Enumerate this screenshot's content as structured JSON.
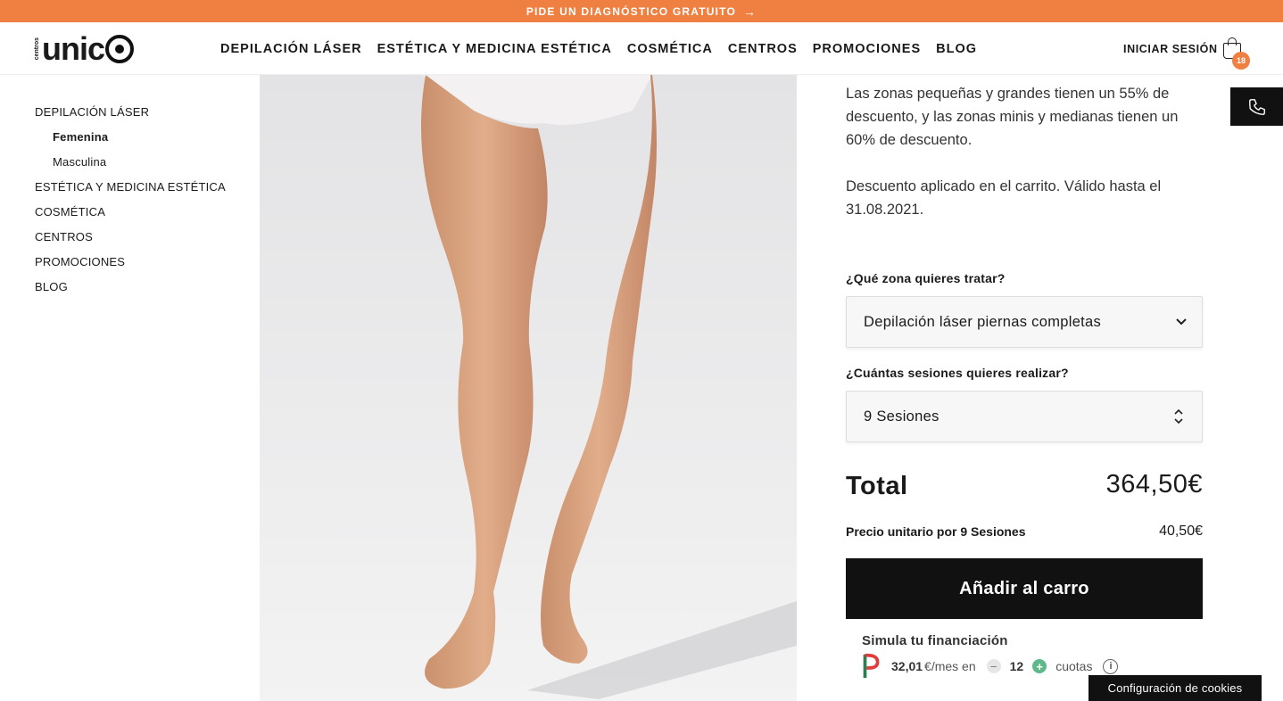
{
  "promo_bar": {
    "text": "PIDE UN DIAGNÓSTICO GRATUITO",
    "arrow": "→"
  },
  "logo": {
    "small": "centros",
    "word": "unic"
  },
  "nav": [
    "DEPILACIÓN LÁSER",
    "ESTÉTICA Y MEDICINA ESTÉTICA",
    "COSMÉTICA",
    "CENTROS",
    "PROMOCIONES",
    "BLOG"
  ],
  "header": {
    "login": "INICIAR SESIÓN",
    "cart_count": "18"
  },
  "sidebar": {
    "items": [
      {
        "label": "DEPILACIÓN LÁSER",
        "sub": false,
        "active": false
      },
      {
        "label": "Femenina",
        "sub": true,
        "active": true
      },
      {
        "label": "Masculina",
        "sub": true,
        "active": false
      },
      {
        "label": "ESTÉTICA Y MEDICINA ESTÉTICA",
        "sub": false,
        "active": false
      },
      {
        "label": "COSMÉTICA",
        "sub": false,
        "active": false
      },
      {
        "label": "CENTROS",
        "sub": false,
        "active": false
      },
      {
        "label": "PROMOCIONES",
        "sub": false,
        "active": false
      },
      {
        "label": "BLOG",
        "sub": false,
        "active": false
      }
    ]
  },
  "product": {
    "desc1": "Las zonas pequeñas y grandes tienen un 55% de descuento, y las zonas minis y medianas tienen un 60% de descuento.",
    "desc2": "Descuento aplicado en el carrito. Válido hasta el 31.08.2021.",
    "zone_label": "¿Qué zona quieres tratar?",
    "zone_value": "Depilación láser piernas completas",
    "sessions_label": "¿Cuántas sesiones quieres realizar?",
    "sessions_value": "9 Sesiones",
    "total_label": "Total",
    "total_value": "364,50€",
    "unit_label": "Precio unitario por 9 Sesiones",
    "unit_value": "40,50€",
    "add_to_cart": "Añadir al carro"
  },
  "financing": {
    "title": "Simula tu financiación",
    "amount": "32,01",
    "per_month": "€/mes en",
    "installments": "12",
    "cuotas": "cuotas"
  },
  "cookies": "Configuración de cookies",
  "colors": {
    "accent": "#f08042",
    "dark": "#111111",
    "plus": "#5fb88a"
  },
  "icons": [
    "arrow-right-icon",
    "cart-icon",
    "phone-icon",
    "chevron-down-icon",
    "updown-icon",
    "minus-icon",
    "plus-icon",
    "info-icon"
  ]
}
